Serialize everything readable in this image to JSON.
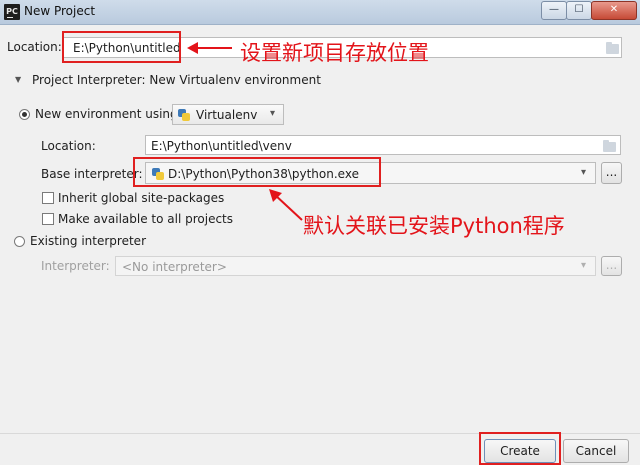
{
  "window": {
    "title": "New Project",
    "app_icon_text": "PC"
  },
  "location": {
    "label": "Location:",
    "value": "E:\\Python\\untitled"
  },
  "interpreter_section": {
    "toggle": "▼",
    "header": "Project Interpreter: New Virtualenv environment"
  },
  "new_env": {
    "radio_label": "New environment using",
    "tool": "Virtualenv",
    "location_label": "Location:",
    "location_value": "E:\\Python\\untitled\\venv",
    "base_label": "Base interpreter:",
    "base_value": "D:\\Python\\Python38\\python.exe",
    "browse": "...",
    "inherit_label": "Inherit global site-packages",
    "available_label": "Make available to all projects"
  },
  "existing": {
    "radio_label": "Existing interpreter",
    "interpreter_label": "Interpreter:",
    "interpreter_value": "<No interpreter>",
    "browse": "..."
  },
  "buttons": {
    "create": "Create",
    "cancel": "Cancel"
  },
  "annotations": {
    "location_note": "设置新项目存放位置",
    "interpreter_note": "默认关联已安装Python程序"
  },
  "colors": {
    "annotation": "#e3141a",
    "python_blue": "#3e7ab8",
    "python_yellow": "#f0c93a"
  }
}
